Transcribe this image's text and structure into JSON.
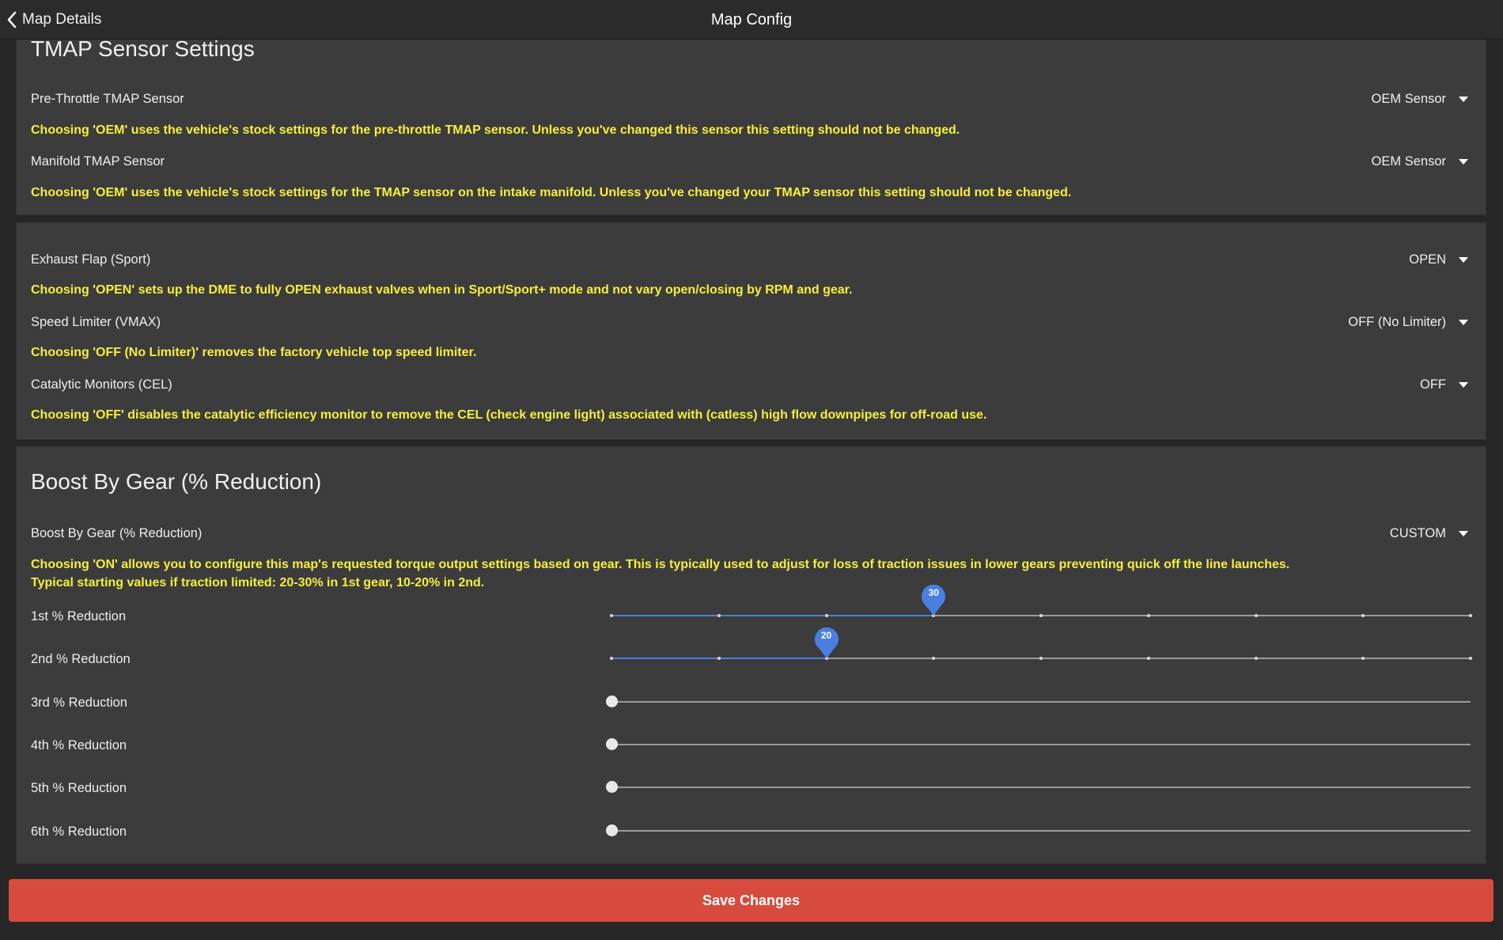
{
  "nav": {
    "back_label": "Map Details",
    "title": "Map Config"
  },
  "tmap": {
    "heading": "TMAP Sensor Settings",
    "rows": [
      {
        "label": "Pre-Throttle TMAP Sensor",
        "value": "OEM Sensor",
        "note": "Choosing 'OEM' uses the vehicle's stock settings for the pre-throttle TMAP sensor. Unless you've changed this sensor this setting should not be changed."
      },
      {
        "label": "Manifold TMAP Sensor",
        "value": "OEM Sensor",
        "note": "Choosing 'OEM' uses the vehicle's stock settings for the TMAP sensor on the intake manifold. Unless you've changed your TMAP sensor this setting should not be changed."
      }
    ]
  },
  "features": {
    "rows": [
      {
        "label": "Exhaust Flap (Sport)",
        "value": "OPEN",
        "note": "Choosing 'OPEN' sets up the DME to fully OPEN exhaust valves when in Sport/Sport+ mode and not vary open/closing by RPM and gear."
      },
      {
        "label": "Speed Limiter (VMAX)",
        "value": "OFF (No Limiter)",
        "note": "Choosing 'OFF (No Limiter)' removes the factory vehicle top speed limiter."
      },
      {
        "label": "Catalytic Monitors (CEL)",
        "value": "OFF",
        "note": "Choosing 'OFF' disables the catalytic efficiency monitor to remove the CEL (check engine light) associated with (catless) high flow downpipes for off-road use."
      }
    ]
  },
  "boost": {
    "heading": "Boost By Gear (% Reduction)",
    "mode_label": "Boost By Gear (% Reduction)",
    "mode_value": "CUSTOM",
    "note_line1": "Choosing 'ON' allows you to configure this map's requested torque output settings based on gear. This is typically used to adjust for loss of traction issues in lower gears preventing quick off the line launches.",
    "note_line2": "Typical starting values if traction limited: 20-30% in 1st gear, 10-20% in 2nd.",
    "slider_max": 80,
    "slider_step": 10,
    "gears": [
      {
        "label": "1st % Reduction",
        "value": 30,
        "active": true
      },
      {
        "label": "2nd % Reduction",
        "value": 20,
        "active": true
      },
      {
        "label": "3rd % Reduction",
        "value": 0,
        "active": false
      },
      {
        "label": "4th % Reduction",
        "value": 0,
        "active": false
      },
      {
        "label": "5th % Reduction",
        "value": 0,
        "active": false
      },
      {
        "label": "6th % Reduction",
        "value": 0,
        "active": false
      }
    ]
  },
  "colors": {
    "accent_blue": "#4a7fe0",
    "note_yellow": "#f6ef3c",
    "save_red": "#d64b3e"
  },
  "save_label": "Save Changes"
}
